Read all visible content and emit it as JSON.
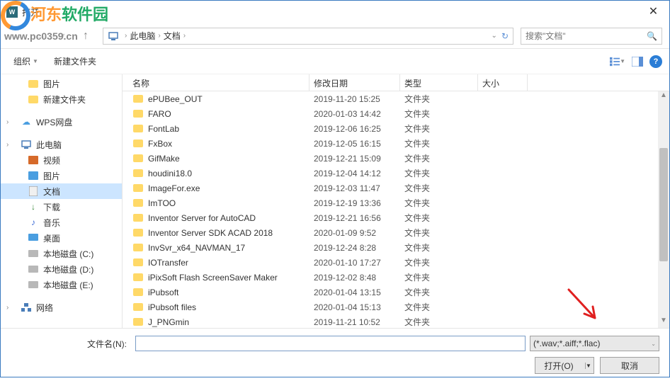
{
  "title": "打开",
  "watermark": {
    "text1": "河东",
    "text2": "软件园",
    "url": "www.pc0359.cn"
  },
  "breadcrumb": {
    "root": "此电脑",
    "current": "文档"
  },
  "search": {
    "placeholder": "搜索\"文档\""
  },
  "toolbar": {
    "organize": "组织",
    "newfolder": "新建文件夹"
  },
  "sidebar": {
    "items": [
      {
        "label": "图片",
        "icon": "folder",
        "lvl": 2
      },
      {
        "label": "新建文件夹",
        "icon": "folder",
        "lvl": 2
      },
      {
        "label": "WPS网盘",
        "icon": "cloud",
        "lvl": 1,
        "color": "#4a9ee0",
        "chev": true
      },
      {
        "label": "此电脑",
        "icon": "pc",
        "lvl": 1,
        "chev": true
      },
      {
        "label": "视频",
        "icon": "video",
        "lvl": 2
      },
      {
        "label": "图片",
        "icon": "image",
        "lvl": 2
      },
      {
        "label": "文档",
        "icon": "doc",
        "lvl": 2,
        "selected": true
      },
      {
        "label": "下载",
        "icon": "download",
        "lvl": 2
      },
      {
        "label": "音乐",
        "icon": "music",
        "lvl": 2
      },
      {
        "label": "桌面",
        "icon": "desktop",
        "lvl": 2
      },
      {
        "label": "本地磁盘 (C:)",
        "icon": "disk",
        "lvl": 2
      },
      {
        "label": "本地磁盘 (D:)",
        "icon": "disk",
        "lvl": 2
      },
      {
        "label": "本地磁盘 (E:)",
        "icon": "disk",
        "lvl": 2
      },
      {
        "label": "网络",
        "icon": "network",
        "lvl": 1,
        "chev": true
      }
    ]
  },
  "columns": {
    "name": "名称",
    "date": "修改日期",
    "type": "类型",
    "size": "大小"
  },
  "files": [
    {
      "name": "ePUBee_OUT",
      "date": "2019-11-20 15:25",
      "type": "文件夹"
    },
    {
      "name": "FARO",
      "date": "2020-01-03 14:42",
      "type": "文件夹"
    },
    {
      "name": "FontLab",
      "date": "2019-12-06 16:25",
      "type": "文件夹"
    },
    {
      "name": "FxBox",
      "date": "2019-12-05 16:15",
      "type": "文件夹"
    },
    {
      "name": "GifMake",
      "date": "2019-12-21 15:09",
      "type": "文件夹"
    },
    {
      "name": "houdini18.0",
      "date": "2019-12-04 14:12",
      "type": "文件夹"
    },
    {
      "name": "ImageFor.exe",
      "date": "2019-12-03 11:47",
      "type": "文件夹"
    },
    {
      "name": "ImTOO",
      "date": "2019-12-19 13:36",
      "type": "文件夹"
    },
    {
      "name": "Inventor Server for AutoCAD",
      "date": "2019-12-21 16:56",
      "type": "文件夹"
    },
    {
      "name": "Inventor Server SDK ACAD 2018",
      "date": "2020-01-09 9:52",
      "type": "文件夹"
    },
    {
      "name": "InvSvr_x64_NAVMAN_17",
      "date": "2019-12-24 8:28",
      "type": "文件夹"
    },
    {
      "name": "IOTransfer",
      "date": "2020-01-10 17:27",
      "type": "文件夹"
    },
    {
      "name": "iPixSoft Flash ScreenSaver Maker",
      "date": "2019-12-02 8:48",
      "type": "文件夹"
    },
    {
      "name": "iPubsoft",
      "date": "2020-01-04 13:15",
      "type": "文件夹"
    },
    {
      "name": "iPubsoft files",
      "date": "2020-01-04 15:13",
      "type": "文件夹"
    },
    {
      "name": "J_PNGmin",
      "date": "2019-11-21 10:52",
      "type": "文件夹"
    }
  ],
  "bottom": {
    "filename_label": "文件名(N):",
    "filetype": "(*.wav;*.aiff;*.flac)",
    "open": "打开(O)",
    "cancel": "取消"
  }
}
